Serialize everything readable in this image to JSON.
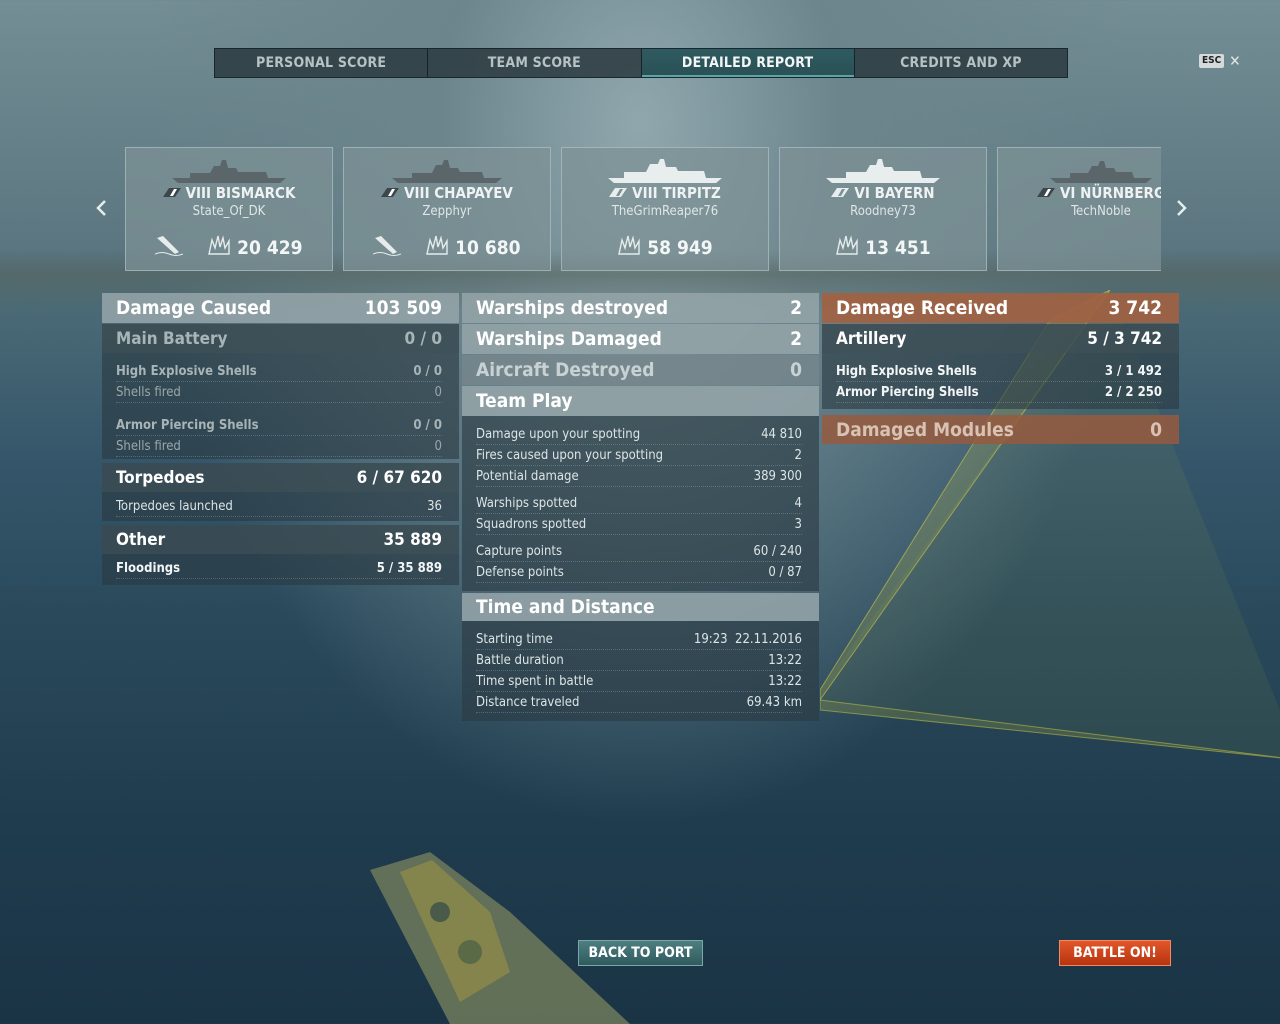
{
  "tabs": [
    {
      "label": "PERSONAL SCORE"
    },
    {
      "label": "TEAM SCORE"
    },
    {
      "label": "DETAILED REPORT"
    },
    {
      "label": "CREDITS AND XP"
    }
  ],
  "esc": {
    "key": "ESC",
    "close": "✕"
  },
  "cards": [
    {
      "ship": "VIII BISMARCK",
      "player": "State_Of_DK",
      "damage": "20 429",
      "sunk": true
    },
    {
      "ship": "VIII CHAPAYEV",
      "player": "Zepphyr",
      "damage": "10 680",
      "sunk": true
    },
    {
      "ship": "VIII TIRPITZ",
      "player": "TheGrimReaper76",
      "damage": "58 949",
      "sunk": false
    },
    {
      "ship": "VI BAYERN",
      "player": "Roodney73",
      "damage": "13 451",
      "sunk": false
    },
    {
      "ship": "VI NÜRNBERG",
      "player": "TechNoble",
      "damage": "",
      "sunk": false
    }
  ],
  "damage_caused": {
    "title": "Damage Caused",
    "value": "103 509",
    "main_battery": {
      "label": "Main Battery",
      "value": "0 / 0"
    },
    "he": {
      "label": "High Explosive Shells",
      "value": "0 / 0"
    },
    "he_fired": {
      "label": "Shells fired",
      "value": "0"
    },
    "ap": {
      "label": "Armor Piercing Shells",
      "value": "0 / 0"
    },
    "ap_fired": {
      "label": "Shells fired",
      "value": "0"
    },
    "torpedoes": {
      "label": "Torpedoes",
      "value": "6 / 67 620"
    },
    "torp_launched": {
      "label": "Torpedoes launched",
      "value": "36"
    },
    "other": {
      "label": "Other",
      "value": "35 889"
    },
    "floodings": {
      "label": "Floodings",
      "value": "5 / 35 889"
    }
  },
  "middle": {
    "destroyed": {
      "label": "Warships destroyed",
      "value": "2"
    },
    "damaged": {
      "label": "Warships Damaged",
      "value": "2"
    },
    "aircraft": {
      "label": "Aircraft Destroyed",
      "value": "0"
    },
    "team_play": {
      "label": "Team Play"
    },
    "spot_damage": {
      "label": "Damage upon your spotting",
      "value": "44 810"
    },
    "spot_fires": {
      "label": "Fires caused upon your spotting",
      "value": "2"
    },
    "potential": {
      "label": "Potential damage",
      "value": "389 300"
    },
    "ships_spotted": {
      "label": "Warships spotted",
      "value": "4"
    },
    "squadrons": {
      "label": "Squadrons spotted",
      "value": "3"
    },
    "capture": {
      "label": "Capture points",
      "value": "60 / 240"
    },
    "defense": {
      "label": "Defense points",
      "value": "0 / 87"
    },
    "time_distance": {
      "label": "Time and Distance"
    },
    "start": {
      "label": "Starting time",
      "value": "19:23  22.11.2016"
    },
    "duration": {
      "label": "Battle duration",
      "value": "13:22"
    },
    "time_spent": {
      "label": "Time spent in battle",
      "value": "13:22"
    },
    "distance": {
      "label": "Distance traveled",
      "value": "69.43 km"
    }
  },
  "received": {
    "title": "Damage Received",
    "value": "3 742",
    "artillery": {
      "label": "Artillery",
      "value": "5 / 3 742"
    },
    "he": {
      "label": "High Explosive Shells",
      "value": "3 / 1 492"
    },
    "ap": {
      "label": "Armor Piercing Shells",
      "value": "2 / 2 250"
    },
    "modules": {
      "label": "Damaged Modules",
      "value": "0"
    }
  },
  "buttons": {
    "back": "BACK TO PORT",
    "battle": "BATTLE ON!"
  }
}
